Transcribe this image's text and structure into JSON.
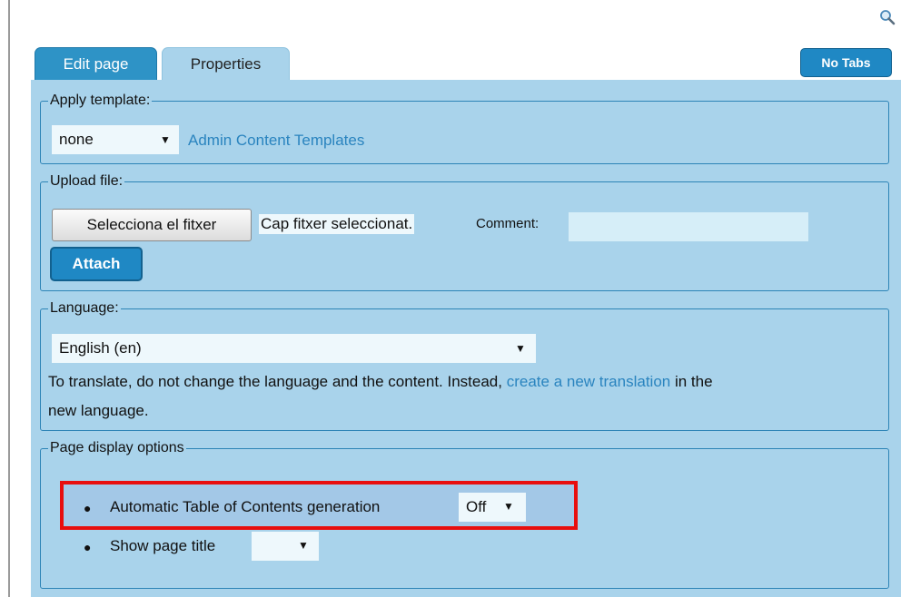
{
  "tabs": [
    {
      "label": "Edit page"
    },
    {
      "label": "Properties"
    }
  ],
  "no_tabs_button": "No Tabs",
  "apply_template": {
    "legend": "Apply template:",
    "selected": "none",
    "link": "Admin Content Templates"
  },
  "upload": {
    "legend": "Upload file:",
    "choose_button": "Selecciona el fitxer",
    "file_status": "Cap fitxer seleccionat.",
    "comment_label": "Comment:",
    "comment_value": "",
    "attach_button": "Attach"
  },
  "language": {
    "legend": "Language:",
    "selected": "English (en)",
    "note_before": "To translate, do not change the language and the content. Instead,",
    "note_link": "create a new translation",
    "note_after": "in the",
    "note_line2": "new language."
  },
  "display_options": {
    "legend": "Page display options",
    "toc_label": "Automatic Table of Contents generation",
    "toc_value": "Off",
    "title_label": "Show page title",
    "title_value": ""
  },
  "icons": {
    "search": "magnifier-icon",
    "dropdown": "triangle-down-icon"
  },
  "colors": {
    "tab_active": "#2e93c6",
    "panel": "#a9d3eb",
    "button": "#1f88c4",
    "link": "#2a84bf",
    "highlight": "#e80e0e"
  }
}
